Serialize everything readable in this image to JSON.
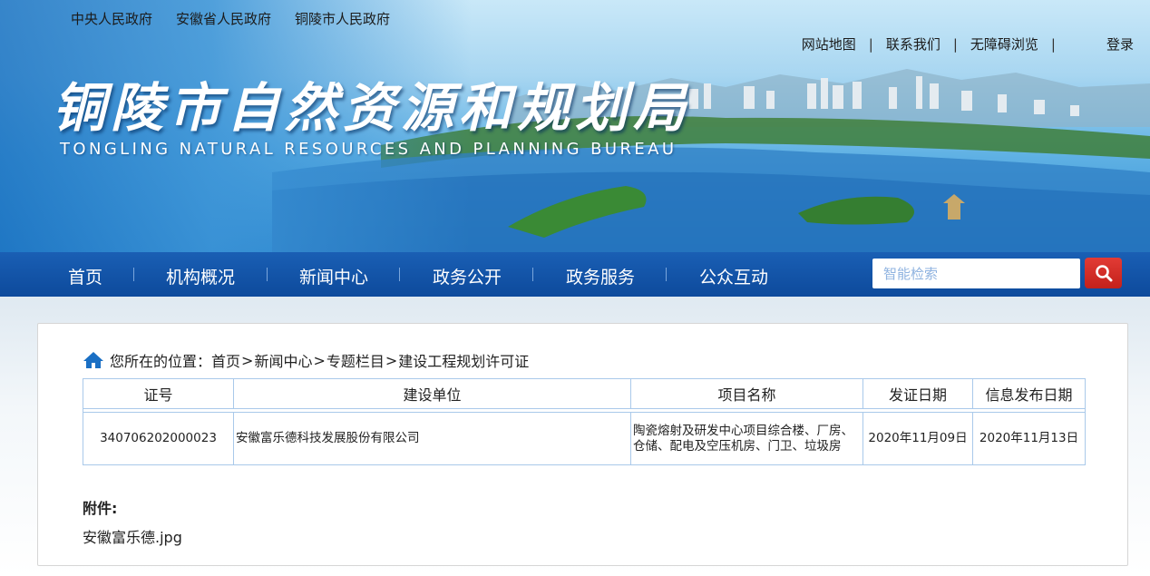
{
  "header": {
    "gov_links": [
      "中央人民政府",
      "安徽省人民政府",
      "铜陵市人民政府"
    ],
    "utility_links": {
      "sitemap": "网站地图",
      "contact": "联系我们",
      "accessibility": "无障碍浏览",
      "separator": "|",
      "login": "登录"
    },
    "logo_cn": "铜陵市自然资源和规划局",
    "logo_en": "TONGLING NATURAL RESOURCES AND PLANNING BUREAU"
  },
  "nav": {
    "items": [
      "首页",
      "机构概况",
      "新闻中心",
      "政务公开",
      "政务服务",
      "公众互动"
    ],
    "search_placeholder": "智能检索"
  },
  "breadcrumb": {
    "prefix": "您所在的位置：",
    "items": [
      "首页",
      "新闻中心",
      "专题栏目",
      "建设工程规划许可证"
    ],
    "separator": ">"
  },
  "table": {
    "headers": [
      "证号",
      "建设单位",
      "项目名称",
      "发证日期",
      "信息发布日期"
    ],
    "rows": [
      [
        "340706202000023",
        "安徽富乐德科技发展股份有限公司",
        "陶瓷熔射及研发中心项目综合楼、厂房、仓储、配电及空压机房、门卫、垃圾房",
        "2020年11月09日",
        "2020年11月13日"
      ]
    ]
  },
  "attachments": {
    "title": "附件:",
    "files": [
      "安徽富乐德.jpg"
    ]
  },
  "colors": {
    "nav_blue": "#0d4a9c",
    "search_red": "#c3211b",
    "table_border": "#a9c9ea",
    "home_icon": "#1a6fc4"
  },
  "icons": {
    "search": "magnifier-icon",
    "home": "home-icon"
  }
}
